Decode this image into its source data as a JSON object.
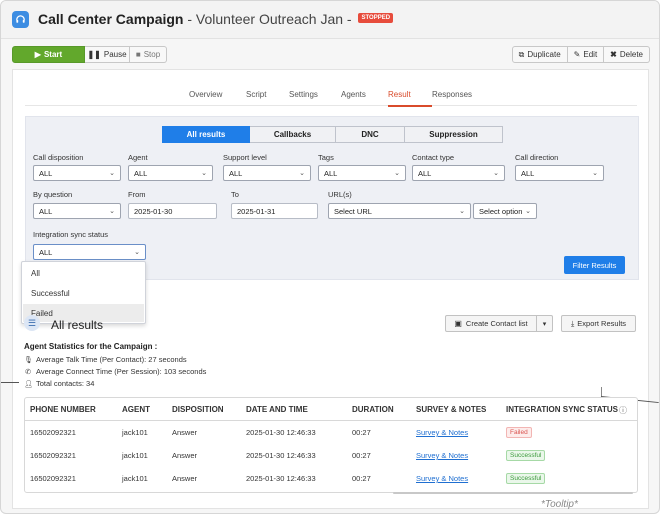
{
  "header": {
    "title_bold": "Call Center Campaign",
    "title_rest": " - Volunteer Outreach Jan - ",
    "status_badge": "STOPPED"
  },
  "toolbar": {
    "start": "Start",
    "pause": "Pause",
    "stop": "Stop",
    "duplicate": "Duplicate",
    "edit": "Edit",
    "delete": "Delete"
  },
  "tabs": [
    "Overview",
    "Script",
    "Settings",
    "Agents",
    "Result",
    "Responses"
  ],
  "active_tab": "Result",
  "result_filters": {
    "segments": [
      "All results",
      "Callbacks",
      "DNC",
      "Suppression"
    ],
    "active_segment": "All results",
    "fields": {
      "call_disposition": {
        "label": "Call disposition",
        "value": "ALL"
      },
      "agent": {
        "label": "Agent",
        "value": "ALL"
      },
      "support_level": {
        "label": "Support level",
        "value": "ALL"
      },
      "tags": {
        "label": "Tags",
        "value": "ALL"
      },
      "contact_type": {
        "label": "Contact type",
        "value": "ALL"
      },
      "call_direction": {
        "label": "Call direction",
        "value": "ALL"
      },
      "by_question": {
        "label": "By question",
        "value": "ALL"
      },
      "from": {
        "label": "From",
        "value": "2025-01-30"
      },
      "to": {
        "label": "To",
        "value": "2025-01-31"
      },
      "urls": {
        "label": "URL(s)",
        "value": "Select URL",
        "option": "Select option"
      },
      "integration_sync_status": {
        "label": "Integration sync status",
        "value": "ALL"
      }
    },
    "filter_button": "Filter Results"
  },
  "sync_dropdown": {
    "options": [
      "All",
      "Successful",
      "Failed"
    ],
    "highlighted": "Failed"
  },
  "results": {
    "title": "All results",
    "create_contact_list": "Create Contact list",
    "export": "Export Results"
  },
  "agent_stats": {
    "title": "Agent Statistics for the Campaign :",
    "avg_talk": "Average Talk Time (Per Contact): 27 seconds",
    "avg_connect": "Average Connect Time (Per Session): 103 seconds",
    "total_contacts": "Total contacts: 34"
  },
  "table": {
    "headers": [
      "PHONE NUMBER",
      "AGENT",
      "DISPOSITION",
      "DATE AND TIME",
      "DURATION",
      "SURVEY & NOTES",
      "INTEGRATION SYNC STATUS"
    ],
    "rows": [
      {
        "phone": "16502092321",
        "agent": "jack101",
        "disposition": "Answer",
        "datetime": "2025-01-30 12:46:33",
        "duration": "00:27",
        "survey": "Survey & Notes",
        "sync": "Failed"
      },
      {
        "phone": "16502092321",
        "agent": "jack101",
        "disposition": "Answer",
        "datetime": "2025-01-30 12:46:33",
        "duration": "00:27",
        "survey": "Survey & Notes",
        "sync": "Successful"
      },
      {
        "phone": "16502092321",
        "agent": "jack101",
        "disposition": "Answer",
        "datetime": "2025-01-30 12:46:33",
        "duration": "00:27",
        "survey": "Survey & Notes",
        "sync": "Successful"
      }
    ]
  },
  "annotation": "*Tooltip*",
  "colors": {
    "accent": "#1f7ee8",
    "start_green": "#62a82c",
    "stopped_red": "#e74c3c",
    "active_tab": "#d94b2b"
  }
}
